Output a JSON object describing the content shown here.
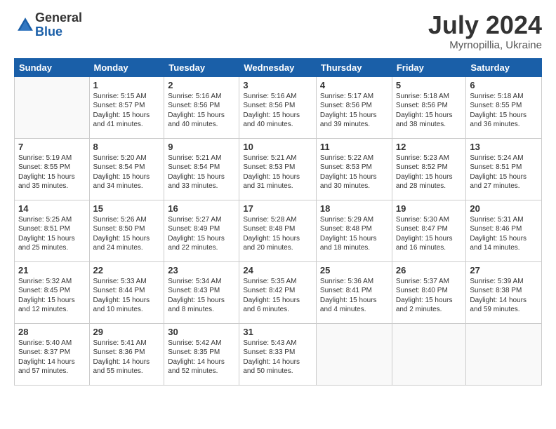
{
  "logo": {
    "general": "General",
    "blue": "Blue"
  },
  "title": {
    "month_year": "July 2024",
    "location": "Myrnopillia, Ukraine"
  },
  "days_of_week": [
    "Sunday",
    "Monday",
    "Tuesday",
    "Wednesday",
    "Thursday",
    "Friday",
    "Saturday"
  ],
  "weeks": [
    [
      {
        "day": "",
        "sunrise": "",
        "sunset": "",
        "daylight": "",
        "empty": true
      },
      {
        "day": "1",
        "sunrise": "Sunrise: 5:15 AM",
        "sunset": "Sunset: 8:57 PM",
        "daylight": "Daylight: 15 hours and 41 minutes."
      },
      {
        "day": "2",
        "sunrise": "Sunrise: 5:16 AM",
        "sunset": "Sunset: 8:56 PM",
        "daylight": "Daylight: 15 hours and 40 minutes."
      },
      {
        "day": "3",
        "sunrise": "Sunrise: 5:16 AM",
        "sunset": "Sunset: 8:56 PM",
        "daylight": "Daylight: 15 hours and 40 minutes."
      },
      {
        "day": "4",
        "sunrise": "Sunrise: 5:17 AM",
        "sunset": "Sunset: 8:56 PM",
        "daylight": "Daylight: 15 hours and 39 minutes."
      },
      {
        "day": "5",
        "sunrise": "Sunrise: 5:18 AM",
        "sunset": "Sunset: 8:56 PM",
        "daylight": "Daylight: 15 hours and 38 minutes."
      },
      {
        "day": "6",
        "sunrise": "Sunrise: 5:18 AM",
        "sunset": "Sunset: 8:55 PM",
        "daylight": "Daylight: 15 hours and 36 minutes."
      }
    ],
    [
      {
        "day": "7",
        "sunrise": "Sunrise: 5:19 AM",
        "sunset": "Sunset: 8:55 PM",
        "daylight": "Daylight: 15 hours and 35 minutes."
      },
      {
        "day": "8",
        "sunrise": "Sunrise: 5:20 AM",
        "sunset": "Sunset: 8:54 PM",
        "daylight": "Daylight: 15 hours and 34 minutes."
      },
      {
        "day": "9",
        "sunrise": "Sunrise: 5:21 AM",
        "sunset": "Sunset: 8:54 PM",
        "daylight": "Daylight: 15 hours and 33 minutes."
      },
      {
        "day": "10",
        "sunrise": "Sunrise: 5:21 AM",
        "sunset": "Sunset: 8:53 PM",
        "daylight": "Daylight: 15 hours and 31 minutes."
      },
      {
        "day": "11",
        "sunrise": "Sunrise: 5:22 AM",
        "sunset": "Sunset: 8:53 PM",
        "daylight": "Daylight: 15 hours and 30 minutes."
      },
      {
        "day": "12",
        "sunrise": "Sunrise: 5:23 AM",
        "sunset": "Sunset: 8:52 PM",
        "daylight": "Daylight: 15 hours and 28 minutes."
      },
      {
        "day": "13",
        "sunrise": "Sunrise: 5:24 AM",
        "sunset": "Sunset: 8:51 PM",
        "daylight": "Daylight: 15 hours and 27 minutes."
      }
    ],
    [
      {
        "day": "14",
        "sunrise": "Sunrise: 5:25 AM",
        "sunset": "Sunset: 8:51 PM",
        "daylight": "Daylight: 15 hours and 25 minutes."
      },
      {
        "day": "15",
        "sunrise": "Sunrise: 5:26 AM",
        "sunset": "Sunset: 8:50 PM",
        "daylight": "Daylight: 15 hours and 24 minutes."
      },
      {
        "day": "16",
        "sunrise": "Sunrise: 5:27 AM",
        "sunset": "Sunset: 8:49 PM",
        "daylight": "Daylight: 15 hours and 22 minutes."
      },
      {
        "day": "17",
        "sunrise": "Sunrise: 5:28 AM",
        "sunset": "Sunset: 8:48 PM",
        "daylight": "Daylight: 15 hours and 20 minutes."
      },
      {
        "day": "18",
        "sunrise": "Sunrise: 5:29 AM",
        "sunset": "Sunset: 8:48 PM",
        "daylight": "Daylight: 15 hours and 18 minutes."
      },
      {
        "day": "19",
        "sunrise": "Sunrise: 5:30 AM",
        "sunset": "Sunset: 8:47 PM",
        "daylight": "Daylight: 15 hours and 16 minutes."
      },
      {
        "day": "20",
        "sunrise": "Sunrise: 5:31 AM",
        "sunset": "Sunset: 8:46 PM",
        "daylight": "Daylight: 15 hours and 14 minutes."
      }
    ],
    [
      {
        "day": "21",
        "sunrise": "Sunrise: 5:32 AM",
        "sunset": "Sunset: 8:45 PM",
        "daylight": "Daylight: 15 hours and 12 minutes."
      },
      {
        "day": "22",
        "sunrise": "Sunrise: 5:33 AM",
        "sunset": "Sunset: 8:44 PM",
        "daylight": "Daylight: 15 hours and 10 minutes."
      },
      {
        "day": "23",
        "sunrise": "Sunrise: 5:34 AM",
        "sunset": "Sunset: 8:43 PM",
        "daylight": "Daylight: 15 hours and 8 minutes."
      },
      {
        "day": "24",
        "sunrise": "Sunrise: 5:35 AM",
        "sunset": "Sunset: 8:42 PM",
        "daylight": "Daylight: 15 hours and 6 minutes."
      },
      {
        "day": "25",
        "sunrise": "Sunrise: 5:36 AM",
        "sunset": "Sunset: 8:41 PM",
        "daylight": "Daylight: 15 hours and 4 minutes."
      },
      {
        "day": "26",
        "sunrise": "Sunrise: 5:37 AM",
        "sunset": "Sunset: 8:40 PM",
        "daylight": "Daylight: 15 hours and 2 minutes."
      },
      {
        "day": "27",
        "sunrise": "Sunrise: 5:39 AM",
        "sunset": "Sunset: 8:38 PM",
        "daylight": "Daylight: 14 hours and 59 minutes."
      }
    ],
    [
      {
        "day": "28",
        "sunrise": "Sunrise: 5:40 AM",
        "sunset": "Sunset: 8:37 PM",
        "daylight": "Daylight: 14 hours and 57 minutes."
      },
      {
        "day": "29",
        "sunrise": "Sunrise: 5:41 AM",
        "sunset": "Sunset: 8:36 PM",
        "daylight": "Daylight: 14 hours and 55 minutes."
      },
      {
        "day": "30",
        "sunrise": "Sunrise: 5:42 AM",
        "sunset": "Sunset: 8:35 PM",
        "daylight": "Daylight: 14 hours and 52 minutes."
      },
      {
        "day": "31",
        "sunrise": "Sunrise: 5:43 AM",
        "sunset": "Sunset: 8:33 PM",
        "daylight": "Daylight: 14 hours and 50 minutes."
      },
      {
        "day": "",
        "sunrise": "",
        "sunset": "",
        "daylight": "",
        "empty": true
      },
      {
        "day": "",
        "sunrise": "",
        "sunset": "",
        "daylight": "",
        "empty": true
      },
      {
        "day": "",
        "sunrise": "",
        "sunset": "",
        "daylight": "",
        "empty": true
      }
    ]
  ]
}
